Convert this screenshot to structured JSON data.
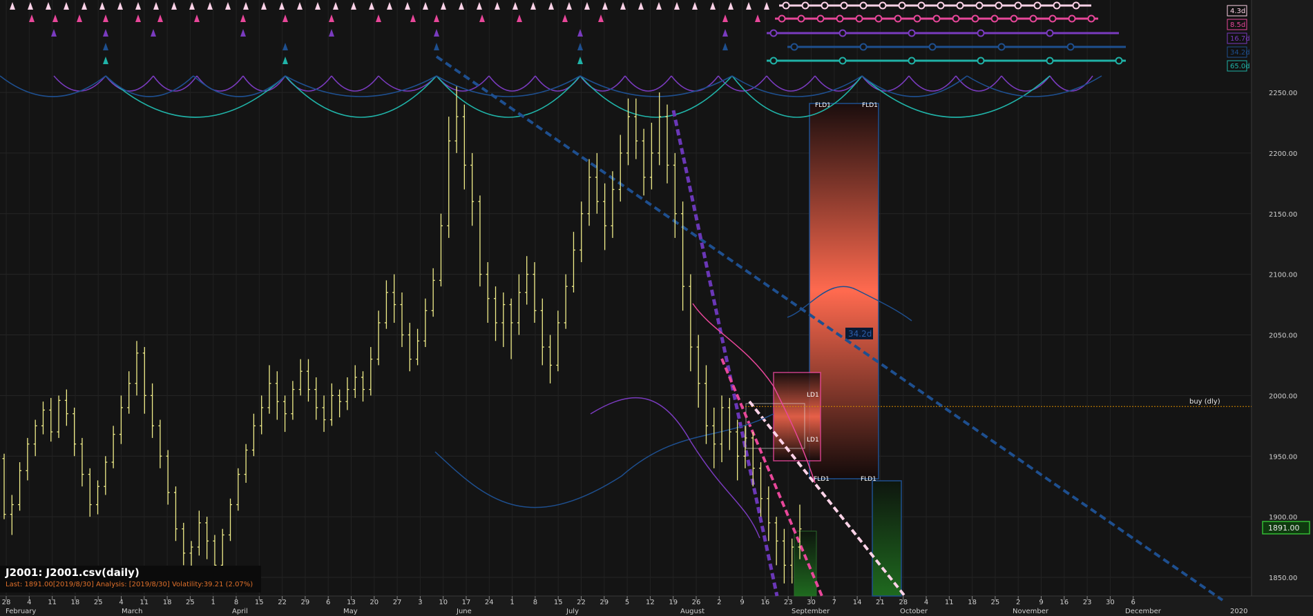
{
  "chart_data": {
    "type": "bar",
    "subtype": "ohlc",
    "symbol": "J2001",
    "title": "J2001: J2001.csv(daily)",
    "subtitle": "Last: 1891.00[2019/8/30] Analysis: [2019/8/30] Volatility:39.21 (2.07%)",
    "last_price_label": "1891.00",
    "buy_label": "buy (dly)",
    "buy_level": 1991,
    "ylim": [
      1830,
      2290
    ],
    "y_ticks": [
      1850,
      1900,
      1950,
      2000,
      2050,
      2100,
      2150,
      2200,
      2250
    ],
    "y_tick_labels": [
      "1850.00",
      "1900.00",
      "1950.00",
      "2000.00",
      "2050.00",
      "2100.00",
      "2150.00",
      "2200.00",
      "2250.00"
    ],
    "x_day_labels": [
      "28",
      "4",
      "11",
      "18",
      "25",
      "4",
      "11",
      "18",
      "25",
      "1",
      "8",
      "15",
      "22",
      "29",
      "6",
      "13",
      "20",
      "27",
      "3",
      "10",
      "17",
      "24",
      "1",
      "8",
      "15",
      "22",
      "29",
      "5",
      "12",
      "19",
      "26",
      "2",
      "9",
      "16",
      "23",
      "30",
      "7",
      "14",
      "21",
      "28",
      "4",
      "11",
      "18",
      "25",
      "2",
      "9",
      "16",
      "23",
      "30",
      "6"
    ],
    "x_month_labels": [
      "February",
      "March",
      "April",
      "May",
      "June",
      "July",
      "August",
      "September",
      "October",
      "November",
      "December",
      "2020"
    ],
    "cycle_legend": [
      "4.3d",
      "8.5d",
      "16.7d",
      "34.2d",
      "65.0d"
    ],
    "cycle_colors": [
      "#ffd3e8",
      "#e8479a",
      "#7a3bbf",
      "#1e4f8f",
      "#20b3a8"
    ],
    "fld_labels": [
      "FLD1",
      "FLD1",
      "FLD1",
      "FLD1",
      "LD1",
      "LD1"
    ],
    "projection_label": "34.2d",
    "series": [
      {
        "ohlc": [
          [
            1948,
            1902,
            1952,
            1898
          ],
          [
            1902,
            1910,
            1918,
            1885
          ],
          [
            1910,
            1938,
            1945,
            1905
          ],
          [
            1938,
            1960,
            1965,
            1930
          ],
          [
            1960,
            1975,
            1980,
            1950
          ],
          [
            1975,
            1988,
            1995,
            1968
          ],
          [
            1988,
            1970,
            1998,
            1962
          ],
          [
            1970,
            1996,
            2000,
            1965
          ],
          [
            1996,
            1985,
            2005,
            1975
          ],
          [
            1985,
            1960,
            1990,
            1950
          ],
          [
            1960,
            1935,
            1965,
            1925
          ],
          [
            1935,
            1910,
            1940,
            1900
          ],
          [
            1910,
            1925,
            1930,
            1902
          ],
          [
            1925,
            1945,
            1950,
            1918
          ],
          [
            1945,
            1968,
            1975,
            1940
          ],
          [
            1968,
            1990,
            2000,
            1960
          ],
          [
            1990,
            2010,
            2020,
            1985
          ],
          [
            2010,
            2035,
            2045,
            2000
          ],
          [
            2035,
            2000,
            2040,
            1985
          ],
          [
            2000,
            1975,
            2010,
            1965
          ],
          [
            1975,
            1950,
            1980,
            1940
          ],
          [
            1950,
            1920,
            1955,
            1910
          ],
          [
            1920,
            1890,
            1925,
            1880
          ],
          [
            1890,
            1870,
            1895,
            1860
          ],
          [
            1870,
            1875,
            1880,
            1850
          ],
          [
            1875,
            1895,
            1905,
            1868
          ],
          [
            1895,
            1880,
            1900,
            1865
          ],
          [
            1880,
            1860,
            1885,
            1852
          ],
          [
            1860,
            1885,
            1890,
            1855
          ],
          [
            1885,
            1910,
            1915,
            1880
          ],
          [
            1910,
            1935,
            1940,
            1905
          ],
          [
            1935,
            1955,
            1960,
            1928
          ],
          [
            1955,
            1975,
            1985,
            1950
          ],
          [
            1975,
            1990,
            2000,
            1968
          ],
          [
            1990,
            2010,
            2025,
            1985
          ],
          [
            2010,
            1995,
            2020,
            1980
          ],
          [
            1995,
            1985,
            2000,
            1970
          ],
          [
            1985,
            2005,
            2012,
            1980
          ],
          [
            2005,
            2020,
            2030,
            2000
          ],
          [
            2020,
            2005,
            2030,
            1995
          ],
          [
            2005,
            1990,
            2015,
            1980
          ],
          [
            1990,
            1980,
            2000,
            1970
          ],
          [
            1980,
            2000,
            2010,
            1975
          ],
          [
            2000,
            1995,
            2005,
            1982
          ],
          [
            1995,
            2005,
            2015,
            1988
          ],
          [
            2005,
            2015,
            2025,
            1998
          ],
          [
            2015,
            2005,
            2020,
            1995
          ],
          [
            2005,
            2030,
            2040,
            2000
          ],
          [
            2030,
            2060,
            2070,
            2025
          ],
          [
            2060,
            2085,
            2095,
            2055
          ],
          [
            2085,
            2075,
            2100,
            2060
          ],
          [
            2075,
            2050,
            2085,
            2040
          ],
          [
            2050,
            2030,
            2060,
            2020
          ],
          [
            2030,
            2045,
            2055,
            2025
          ],
          [
            2045,
            2070,
            2080,
            2040
          ],
          [
            2070,
            2095,
            2105,
            2065
          ],
          [
            2095,
            2140,
            2150,
            2090
          ],
          [
            2140,
            2210,
            2230,
            2130
          ],
          [
            2210,
            2230,
            2255,
            2200
          ],
          [
            2230,
            2190,
            2240,
            2170
          ],
          [
            2190,
            2160,
            2200,
            2140
          ],
          [
            2160,
            2100,
            2165,
            2090
          ],
          [
            2100,
            2080,
            2110,
            2060
          ],
          [
            2080,
            2060,
            2090,
            2045
          ],
          [
            2060,
            2075,
            2085,
            2040
          ],
          [
            2075,
            2060,
            2080,
            2030
          ],
          [
            2060,
            2085,
            2100,
            2050
          ],
          [
            2085,
            2100,
            2115,
            2075
          ],
          [
            2100,
            2070,
            2110,
            2060
          ],
          [
            2070,
            2040,
            2080,
            2025
          ],
          [
            2040,
            2025,
            2050,
            2010
          ],
          [
            2025,
            2060,
            2070,
            2020
          ],
          [
            2060,
            2090,
            2100,
            2055
          ],
          [
            2090,
            2120,
            2135,
            2085
          ],
          [
            2120,
            2150,
            2160,
            2110
          ],
          [
            2150,
            2180,
            2195,
            2140
          ],
          [
            2180,
            2160,
            2200,
            2150
          ],
          [
            2160,
            2140,
            2175,
            2120
          ],
          [
            2140,
            2170,
            2185,
            2130
          ],
          [
            2170,
            2200,
            2215,
            2160
          ],
          [
            2200,
            2230,
            2245,
            2190
          ],
          [
            2230,
            2210,
            2245,
            2195
          ],
          [
            2210,
            2180,
            2220,
            2165
          ],
          [
            2180,
            2200,
            2225,
            2170
          ],
          [
            2200,
            2230,
            2250,
            2190
          ],
          [
            2230,
            2190,
            2240,
            2175
          ],
          [
            2190,
            2150,
            2200,
            2130
          ],
          [
            2150,
            2090,
            2160,
            2070
          ],
          [
            2090,
            2040,
            2100,
            2020
          ],
          [
            2040,
            2010,
            2050,
            1990
          ],
          [
            2010,
            1975,
            2025,
            1960
          ],
          [
            1975,
            1960,
            1990,
            1940
          ],
          [
            1960,
            1990,
            2000,
            1945
          ],
          [
            1990,
            1970,
            1998,
            1955
          ],
          [
            1970,
            1950,
            1980,
            1930
          ],
          [
            1950,
            1965,
            1975,
            1940
          ],
          [
            1965,
            1940,
            1970,
            1925
          ],
          [
            1940,
            1915,
            1945,
            1900
          ],
          [
            1915,
            1895,
            1925,
            1880
          ],
          [
            1895,
            1880,
            1900,
            1860
          ],
          [
            1880,
            1860,
            1890,
            1845
          ],
          [
            1860,
            1875,
            1882,
            1845
          ],
          [
            1875,
            1890,
            1910,
            1865
          ]
        ]
      }
    ]
  }
}
